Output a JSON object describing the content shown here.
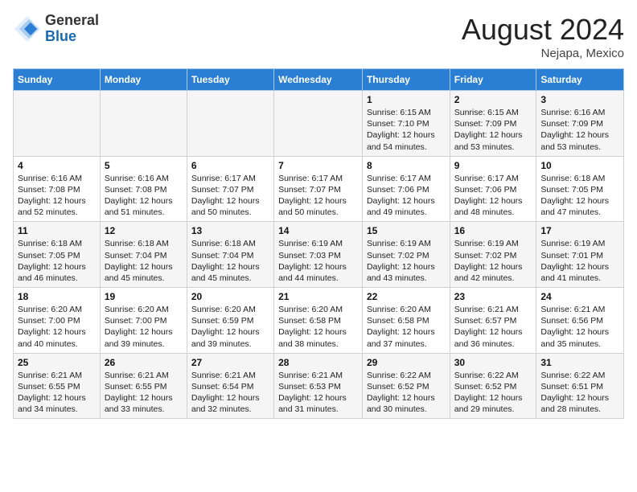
{
  "header": {
    "logo_general": "General",
    "logo_blue": "Blue",
    "month_year": "August 2024",
    "location": "Nejapa, Mexico"
  },
  "days_of_week": [
    "Sunday",
    "Monday",
    "Tuesday",
    "Wednesday",
    "Thursday",
    "Friday",
    "Saturday"
  ],
  "weeks": [
    [
      {
        "day": "",
        "info": ""
      },
      {
        "day": "",
        "info": ""
      },
      {
        "day": "",
        "info": ""
      },
      {
        "day": "",
        "info": ""
      },
      {
        "day": "1",
        "info": "Sunrise: 6:15 AM\nSunset: 7:10 PM\nDaylight: 12 hours\nand 54 minutes."
      },
      {
        "day": "2",
        "info": "Sunrise: 6:15 AM\nSunset: 7:09 PM\nDaylight: 12 hours\nand 53 minutes."
      },
      {
        "day": "3",
        "info": "Sunrise: 6:16 AM\nSunset: 7:09 PM\nDaylight: 12 hours\nand 53 minutes."
      }
    ],
    [
      {
        "day": "4",
        "info": "Sunrise: 6:16 AM\nSunset: 7:08 PM\nDaylight: 12 hours\nand 52 minutes."
      },
      {
        "day": "5",
        "info": "Sunrise: 6:16 AM\nSunset: 7:08 PM\nDaylight: 12 hours\nand 51 minutes."
      },
      {
        "day": "6",
        "info": "Sunrise: 6:17 AM\nSunset: 7:07 PM\nDaylight: 12 hours\nand 50 minutes."
      },
      {
        "day": "7",
        "info": "Sunrise: 6:17 AM\nSunset: 7:07 PM\nDaylight: 12 hours\nand 50 minutes."
      },
      {
        "day": "8",
        "info": "Sunrise: 6:17 AM\nSunset: 7:06 PM\nDaylight: 12 hours\nand 49 minutes."
      },
      {
        "day": "9",
        "info": "Sunrise: 6:17 AM\nSunset: 7:06 PM\nDaylight: 12 hours\nand 48 minutes."
      },
      {
        "day": "10",
        "info": "Sunrise: 6:18 AM\nSunset: 7:05 PM\nDaylight: 12 hours\nand 47 minutes."
      }
    ],
    [
      {
        "day": "11",
        "info": "Sunrise: 6:18 AM\nSunset: 7:05 PM\nDaylight: 12 hours\nand 46 minutes."
      },
      {
        "day": "12",
        "info": "Sunrise: 6:18 AM\nSunset: 7:04 PM\nDaylight: 12 hours\nand 45 minutes."
      },
      {
        "day": "13",
        "info": "Sunrise: 6:18 AM\nSunset: 7:04 PM\nDaylight: 12 hours\nand 45 minutes."
      },
      {
        "day": "14",
        "info": "Sunrise: 6:19 AM\nSunset: 7:03 PM\nDaylight: 12 hours\nand 44 minutes."
      },
      {
        "day": "15",
        "info": "Sunrise: 6:19 AM\nSunset: 7:02 PM\nDaylight: 12 hours\nand 43 minutes."
      },
      {
        "day": "16",
        "info": "Sunrise: 6:19 AM\nSunset: 7:02 PM\nDaylight: 12 hours\nand 42 minutes."
      },
      {
        "day": "17",
        "info": "Sunrise: 6:19 AM\nSunset: 7:01 PM\nDaylight: 12 hours\nand 41 minutes."
      }
    ],
    [
      {
        "day": "18",
        "info": "Sunrise: 6:20 AM\nSunset: 7:00 PM\nDaylight: 12 hours\nand 40 minutes."
      },
      {
        "day": "19",
        "info": "Sunrise: 6:20 AM\nSunset: 7:00 PM\nDaylight: 12 hours\nand 39 minutes."
      },
      {
        "day": "20",
        "info": "Sunrise: 6:20 AM\nSunset: 6:59 PM\nDaylight: 12 hours\nand 39 minutes."
      },
      {
        "day": "21",
        "info": "Sunrise: 6:20 AM\nSunset: 6:58 PM\nDaylight: 12 hours\nand 38 minutes."
      },
      {
        "day": "22",
        "info": "Sunrise: 6:20 AM\nSunset: 6:58 PM\nDaylight: 12 hours\nand 37 minutes."
      },
      {
        "day": "23",
        "info": "Sunrise: 6:21 AM\nSunset: 6:57 PM\nDaylight: 12 hours\nand 36 minutes."
      },
      {
        "day": "24",
        "info": "Sunrise: 6:21 AM\nSunset: 6:56 PM\nDaylight: 12 hours\nand 35 minutes."
      }
    ],
    [
      {
        "day": "25",
        "info": "Sunrise: 6:21 AM\nSunset: 6:55 PM\nDaylight: 12 hours\nand 34 minutes."
      },
      {
        "day": "26",
        "info": "Sunrise: 6:21 AM\nSunset: 6:55 PM\nDaylight: 12 hours\nand 33 minutes."
      },
      {
        "day": "27",
        "info": "Sunrise: 6:21 AM\nSunset: 6:54 PM\nDaylight: 12 hours\nand 32 minutes."
      },
      {
        "day": "28",
        "info": "Sunrise: 6:21 AM\nSunset: 6:53 PM\nDaylight: 12 hours\nand 31 minutes."
      },
      {
        "day": "29",
        "info": "Sunrise: 6:22 AM\nSunset: 6:52 PM\nDaylight: 12 hours\nand 30 minutes."
      },
      {
        "day": "30",
        "info": "Sunrise: 6:22 AM\nSunset: 6:52 PM\nDaylight: 12 hours\nand 29 minutes."
      },
      {
        "day": "31",
        "info": "Sunrise: 6:22 AM\nSunset: 6:51 PM\nDaylight: 12 hours\nand 28 minutes."
      }
    ]
  ]
}
